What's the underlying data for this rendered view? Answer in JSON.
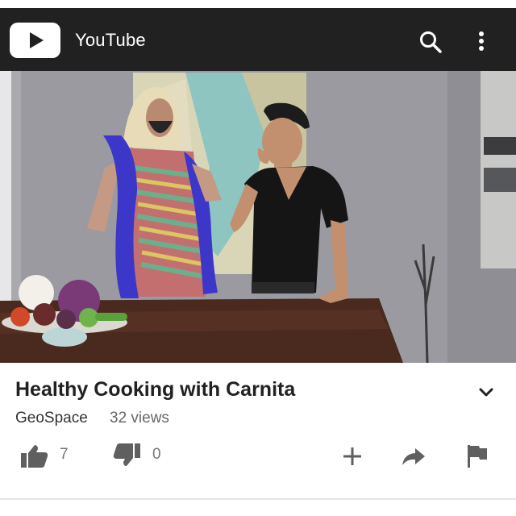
{
  "app": {
    "title": "YouTube"
  },
  "video": {
    "title": "Healthy Cooking with Carnita",
    "channel": "GeoSpace",
    "views": "32 views"
  },
  "actions": {
    "likes": "7",
    "dislikes": "0"
  },
  "icons": {
    "logo": "youtube-play-icon",
    "search": "search-icon",
    "more": "more-vertical-icon",
    "expand": "chevron-down-icon",
    "like": "thumbs-up-icon",
    "dislike": "thumbs-down-icon",
    "add": "plus-icon",
    "share": "share-arrow-icon",
    "report": "flag-icon"
  },
  "colors": {
    "appbar": "#212121",
    "text": "#212121",
    "icon": "#5f5f5f"
  }
}
